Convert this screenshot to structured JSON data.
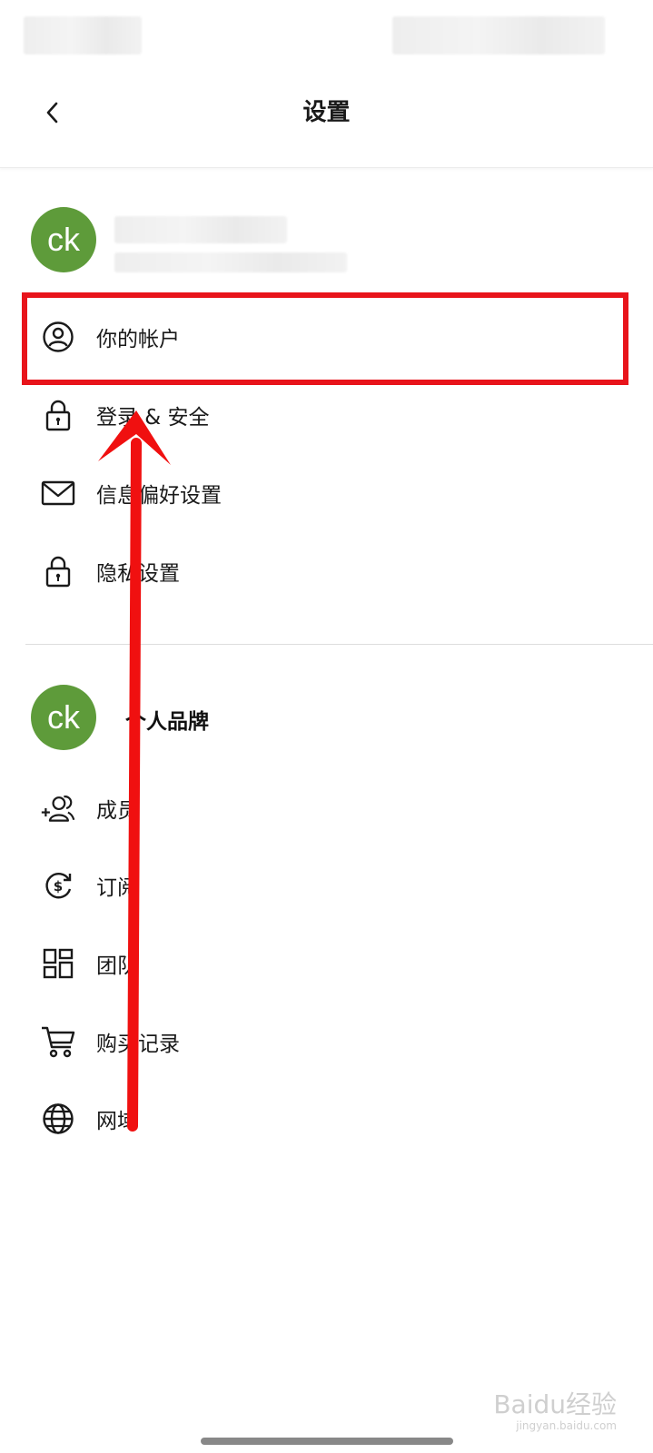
{
  "header": {
    "title": "设置"
  },
  "account": {
    "avatar_initials": "ck",
    "items": [
      {
        "label": "你的帐户",
        "icon": "user-circle-icon"
      },
      {
        "label": "登录 & 安全",
        "icon": "lock-icon"
      },
      {
        "label": "信息偏好设置",
        "icon": "mail-icon"
      },
      {
        "label": "隐私设置",
        "icon": "lock-icon"
      }
    ]
  },
  "brand": {
    "avatar_initials": "ck",
    "name": "个人品牌",
    "items": [
      {
        "label": "成员",
        "icon": "add-user-icon"
      },
      {
        "label": "订阅",
        "icon": "subscription-icon"
      },
      {
        "label": "团队",
        "icon": "grid-icon"
      },
      {
        "label": "购买记录",
        "icon": "cart-icon"
      },
      {
        "label": "网域",
        "icon": "globe-icon"
      }
    ]
  },
  "annotation": {
    "highlight_color": "#e8141b",
    "arrow_color": "#f01010"
  },
  "watermark": {
    "text": "Baidu经验",
    "sub": "jingyan.baidu.com"
  }
}
